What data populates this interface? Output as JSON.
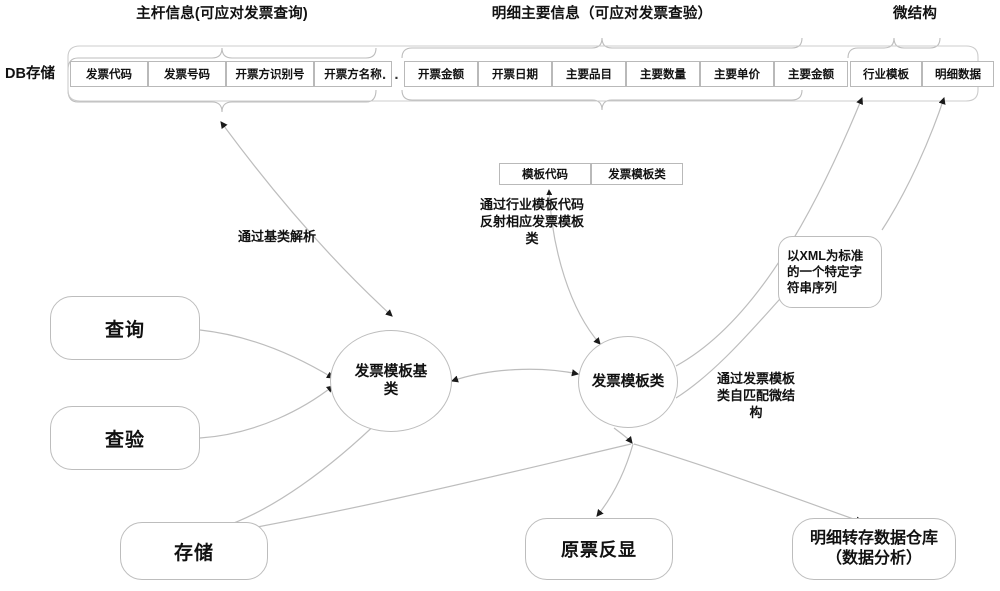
{
  "diagram": {
    "title_groups": [
      {
        "id": "main-info",
        "text": "主杆信息(可应对发票查询)"
      },
      {
        "id": "detail-info",
        "text": "明细主要信息（可应对发票查验）"
      },
      {
        "id": "micro-struct",
        "text": "微结构"
      }
    ],
    "db_label": "DB存储",
    "db_columns_left": [
      "发票代码",
      "发票号码",
      "开票方识别号",
      "开票方名称"
    ],
    "db_ellipsis": ". . .",
    "db_columns_right": [
      "开票金额",
      "开票日期",
      "主要品目",
      "主要数量",
      "主要单价",
      "主要金额",
      "行业模板",
      "明细数据"
    ],
    "template_cells": [
      "模板代码",
      "发票模板类"
    ],
    "annotations": [
      {
        "id": "parse-by-baseclass",
        "text": "通过基类解析"
      },
      {
        "id": "reflect-template",
        "text": "通过行业模板代码反射相应发票模板类"
      },
      {
        "id": "self-match-micro",
        "text": "通过发票模板类自匹配微结构"
      }
    ],
    "nodes": {
      "query": "查询",
      "verify": "查验",
      "base_class": "发票模板基类",
      "template_class": "发票模板类",
      "xml_note": "以XML为标准的一个特定字符串序列",
      "storage": "存储",
      "reprint": "原票反显",
      "warehouse": "明细转存数据仓库（数据分析）"
    },
    "colors": {
      "stroke": "#bdbdbd",
      "text": "#111111",
      "background": "#ffffff",
      "arrow": "#1a1a1a"
    }
  }
}
